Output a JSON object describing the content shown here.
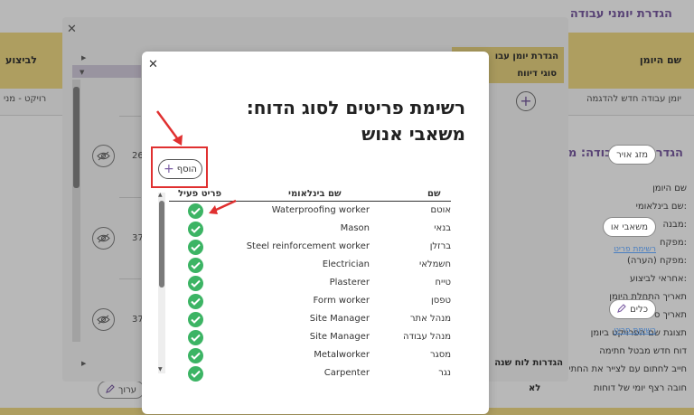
{
  "base": {
    "title": "הגדרת יומני עבודה",
    "yellow_left": "לביצוע",
    "yellow_right": "שם היומן",
    "row1_left": "רויקט - מני",
    "row1_right": "יומן עבודה חדש להדגמה",
    "section_title": "הגדרת יומן עבודה: מר",
    "fields": [
      "שם היומן",
      "שם בינלאומי:",
      "מבנה:",
      "מפקח:",
      "מפקח (הערה):",
      "אחראי לביצוע:",
      "תאריך התחלת היומן",
      "תאריך סיום היומן",
      "תצוגת שם הפרויקט ביומן",
      "דוח חדש מבטל חתימה",
      "חייב לחתום עם לצייר את החתימה",
      "חובה רצף יומי של דוחות"
    ],
    "bottom_value": "לא",
    "edit_label": "ערוך"
  },
  "middle": {
    "header_title": "הגדרת יומן עבו",
    "header_sub": "סוגי דיווח",
    "rows": [
      {
        "num": "26",
        "pill": "מזג אויר",
        "link": ""
      },
      {
        "num": "37",
        "pill": "משאבי או",
        "link": "רשימת פריט"
      },
      {
        "num": "37",
        "pill": "כלים",
        "link": "רשימת פריט"
      }
    ],
    "footer": "הגדרות לוח שנה"
  },
  "dialog": {
    "title": "רשימת פריטים לסוג הדוח:  משאבי אנוש",
    "add_label": "הוסף",
    "columns": {
      "active": "פריט פעיל",
      "intl": "שם בינלאומי",
      "name": "שם"
    },
    "items": [
      {
        "name": "אוטם",
        "intl": "Waterproofing worker"
      },
      {
        "name": "בנאי",
        "intl": "Mason"
      },
      {
        "name": "ברזלן",
        "intl": "Steel reinforcement worker"
      },
      {
        "name": "חשמלאי",
        "intl": "Electrician"
      },
      {
        "name": "טייח",
        "intl": "Plasterer"
      },
      {
        "name": "טפסן",
        "intl": "Form worker"
      },
      {
        "name": "מנהל אתר",
        "intl": "Site Manager"
      },
      {
        "name": "מנהל עבודה",
        "intl": "Site Manager"
      },
      {
        "name": "מסגר",
        "intl": "Metalworker"
      },
      {
        "name": "נגר",
        "intl": "Carpenter"
      }
    ]
  },
  "colors": {
    "accent": "#7a5ca3",
    "yellow": "#f1dc86",
    "check": "#3cb464",
    "highlight": "#e03030"
  }
}
